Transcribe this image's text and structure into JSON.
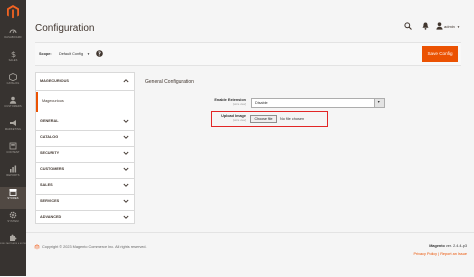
{
  "nav": {
    "items": [
      {
        "label": "DASHBOARD"
      },
      {
        "label": "SALES"
      },
      {
        "label": "CATALOG"
      },
      {
        "label": "CUSTOMERS"
      },
      {
        "label": "MARKETING"
      },
      {
        "label": "CONTENT"
      },
      {
        "label": "REPORTS"
      },
      {
        "label": "STORES"
      },
      {
        "label": "SYSTEM"
      },
      {
        "label": "FIND PARTNERS & EXTENSIONS"
      }
    ]
  },
  "header": {
    "title": "Configuration",
    "user": "admin"
  },
  "scope": {
    "label": "Scope:",
    "value": "Default Config",
    "save_label": "Save Config"
  },
  "tabs": {
    "groups": [
      {
        "label": "MAGECURIOUS",
        "expanded": true,
        "items": [
          {
            "label": "Magecurious"
          }
        ]
      },
      {
        "label": "GENERAL"
      },
      {
        "label": "CATALOG"
      },
      {
        "label": "SECURITY"
      },
      {
        "label": "CUSTOMERS"
      },
      {
        "label": "SALES"
      },
      {
        "label": "SERVICES"
      },
      {
        "label": "ADVANCED"
      }
    ]
  },
  "section": {
    "title": "General Configuration",
    "fields": [
      {
        "label": "Enable Extension",
        "scope": "[store view]",
        "value": "Disable"
      },
      {
        "label": "Upload Image",
        "scope": "[store view]",
        "button": "Choose file",
        "status": "No file chosen"
      }
    ]
  },
  "footer": {
    "copyright": "Copyright © 2023 Magento Commerce Inc. All rights reserved.",
    "version_label": "Magento",
    "version_value": "ver. 2.4.4-p3",
    "privacy": "Privacy Policy",
    "separator": " | ",
    "report": "Report an Issue"
  },
  "colors": {
    "accent": "#eb5202",
    "sidebar": "#373330",
    "highlight": "#e22626"
  }
}
